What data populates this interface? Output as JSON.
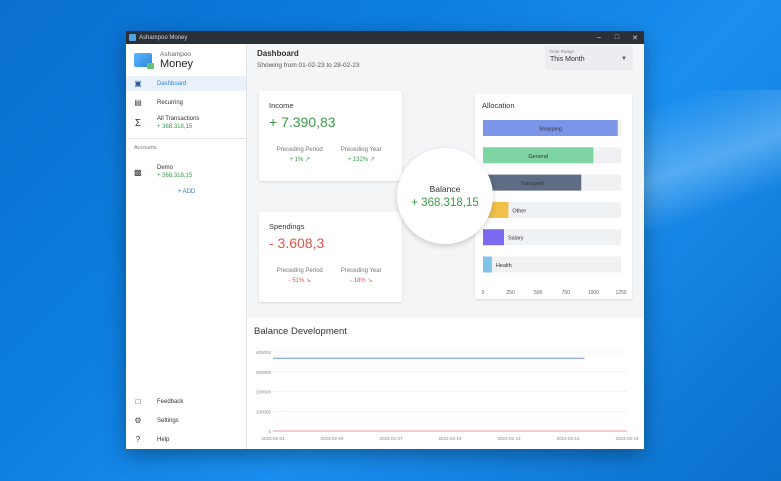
{
  "window": {
    "title": "Ashampoo Money"
  },
  "brand": {
    "line1": "Ashampoo",
    "line2": "Money"
  },
  "nav": [
    {
      "label": "Dashboard",
      "icon": "dashboard-icon"
    },
    {
      "label": "Recurring",
      "icon": "calendar-icon"
    }
  ],
  "all_transactions": {
    "label": "All Transactions",
    "amount": "+ 368.318,15"
  },
  "accounts": {
    "section": "Accounts",
    "items": [
      {
        "name": "Demo",
        "amount": "+ 368.318,15"
      }
    ],
    "add_label": "+ ADD"
  },
  "bottom_nav": [
    {
      "label": "Feedback",
      "icon": "feedback-icon"
    },
    {
      "label": "Settings",
      "icon": "gear-icon"
    },
    {
      "label": "Help",
      "icon": "help-icon"
    }
  ],
  "header": {
    "title": "Dashboard",
    "subtitle": "Showing from 01-02-23 to 28-02-23"
  },
  "date_range": {
    "label": "Date Range",
    "value": "This Month"
  },
  "income": {
    "title": "Income",
    "value": "+ 7.390,83",
    "prev_period_label": "Preceding Period",
    "prev_period_value": "+ 1%",
    "prev_year_label": "Preceding Year",
    "prev_year_value": "+ 132%"
  },
  "spendings": {
    "title": "Spendings",
    "value": "- 3.608,3",
    "prev_period_label": "Preceding Period",
    "prev_period_value": "- 51%",
    "prev_year_label": "Preceding Year",
    "prev_year_value": "- 18%"
  },
  "balance": {
    "title": "Balance",
    "value": "+ 368.318,15"
  },
  "colors": {
    "positive": "#3c9a4a",
    "negative": "#e4544a",
    "accent": "#2f7fd3"
  },
  "allocation": {
    "title": "Allocation",
    "chart_data": {
      "type": "bar",
      "orientation": "horizontal",
      "categories": [
        "Shopping",
        "General",
        "Transport",
        "Other",
        "Salary",
        "Health"
      ],
      "values": [
        1220,
        1000,
        890,
        230,
        190,
        80
      ],
      "colors": [
        "#7b95e8",
        "#7fd4a3",
        "#5e6c86",
        "#f0c04a",
        "#7a6af0",
        "#82c3ea"
      ],
      "xlim": [
        0,
        1250
      ],
      "ticks": [
        "0",
        "250",
        "500",
        "750",
        "1000",
        "1250"
      ]
    }
  },
  "balance_development": {
    "title": "Balance Development",
    "chart_data": {
      "type": "line",
      "x_ticks": [
        "2023-02-01",
        "2023-02-04",
        "2023-02-07",
        "2023-02-10",
        "2023-02-13",
        "2023-02-16",
        "2023-02-19"
      ],
      "y_ticks": [
        "0",
        "100000",
        "200000",
        "300000",
        "400000"
      ],
      "ylim": [
        0,
        400000
      ],
      "series": [
        {
          "values": [
            368000,
            368100,
            368200,
            368300,
            368318,
            368318
          ],
          "color": "#6d92d8"
        },
        {
          "values": [
            0,
            0,
            0,
            0,
            0,
            0,
            0,
            0
          ],
          "color": "#e87a7a"
        }
      ]
    }
  }
}
